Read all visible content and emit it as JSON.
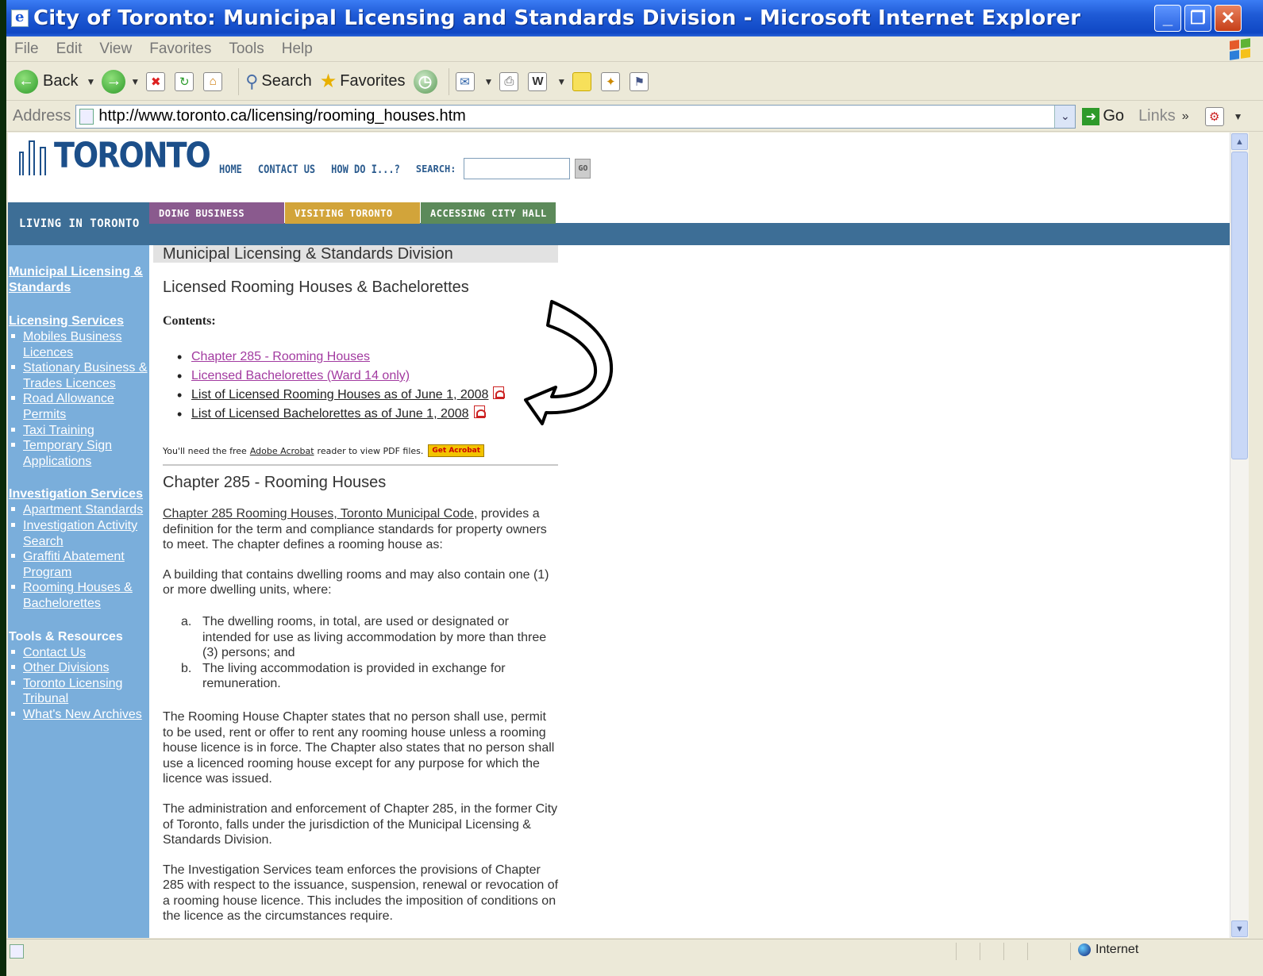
{
  "window": {
    "title": "City of Toronto: Municipal Licensing and Standards Division - Microsoft Internet Explorer",
    "minimize": "_",
    "maximize": "❐",
    "close": "✕"
  },
  "menu": [
    "File",
    "Edit",
    "View",
    "Favorites",
    "Tools",
    "Help"
  ],
  "toolbar": {
    "back": "Back",
    "search": "Search",
    "favorites": "Favorites"
  },
  "address": {
    "label": "Address",
    "url": "http://www.toronto.ca/licensing/rooming_houses.htm",
    "go": "Go",
    "links": "Links",
    "links_more": "»"
  },
  "site": {
    "logo": "TORONTO",
    "nav": [
      "HOME",
      "CONTACT US",
      "HOW DO I...?"
    ],
    "search_label": "SEARCH:",
    "search_value": "",
    "search_go": "GO",
    "tabs": [
      "LIVING IN TORONTO",
      "DOING BUSINESS",
      "VISITING TORONTO",
      "ACCESSING CITY HALL"
    ]
  },
  "sidebar": {
    "home_link": "Municipal Licensing & Standards",
    "licensing": {
      "heading": "Licensing Services",
      "items": [
        "Mobiles Business Licences",
        "Stationary Business & Trades Licences",
        "Road Allowance Permits",
        "Taxi Training",
        "Temporary Sign Applications"
      ]
    },
    "investigation": {
      "heading": "Investigation Services",
      "items": [
        "Apartment Standards",
        "Investigation Activity Search",
        "Graffiti Abatement Program",
        "Rooming Houses & Bachelorettes"
      ]
    },
    "tools": {
      "heading": "Tools & Resources",
      "items": [
        "Contact Us",
        "Other Divisions",
        "Toronto Licensing Tribunal",
        "What's New Archives"
      ]
    }
  },
  "main": {
    "division": "Municipal Licensing & Standards Division",
    "page_title": "Licensed Rooming Houses & Bachelorettes",
    "contents_label": "Contents:",
    "toc": [
      "Chapter 285 - Rooming Houses",
      "Licensed Bachelorettes (Ward 14 only)",
      "List of Licensed Rooming Houses as of June 1, 2008",
      "List of Licensed Bachelorettes as of June 1, 2008"
    ],
    "acrobat_before": "You'll need the free",
    "acrobat_link": "Adobe Acrobat",
    "acrobat_after": "reader to view PDF files.",
    "acrobat_badge": "Get Acrobat",
    "chapter_heading": "Chapter 285 - Rooming Houses",
    "p1_link": "Chapter 285 Rooming Houses, Toronto Municipal Code",
    "p1_rest": ", provides a definition for the term and compliance standards for property owners to meet. The chapter defines a rooming house as:",
    "p2": "A building that contains dwelling rooms and may also contain one (1) or more dwelling units, where:",
    "defs": [
      {
        "mark": "a.",
        "text": "The dwelling rooms, in total, are used or designated or intended for use as living accommodation by more than three (3) persons; and"
      },
      {
        "mark": "b.",
        "text": "The living accommodation is provided in exchange for remuneration."
      }
    ],
    "p3": "The Rooming House Chapter states that no person shall use, permit to be used, rent or offer to rent any rooming house unless a rooming house licence is in force. The Chapter also states that no person shall use a licenced rooming house except for any purpose for which the licence was issued.",
    "p4": "The administration and enforcement of Chapter 285, in the former City of Toronto, falls under the jurisdiction of the Municipal Licensing & Standards Division.",
    "p5": "The Investigation Services team enforces the provisions of Chapter 285 with respect to the issuance, suspension, renewal or revocation of a rooming house licence. This includes the imposition of conditions on the licence as the circumstances require."
  },
  "status": {
    "zone": "Internet"
  }
}
